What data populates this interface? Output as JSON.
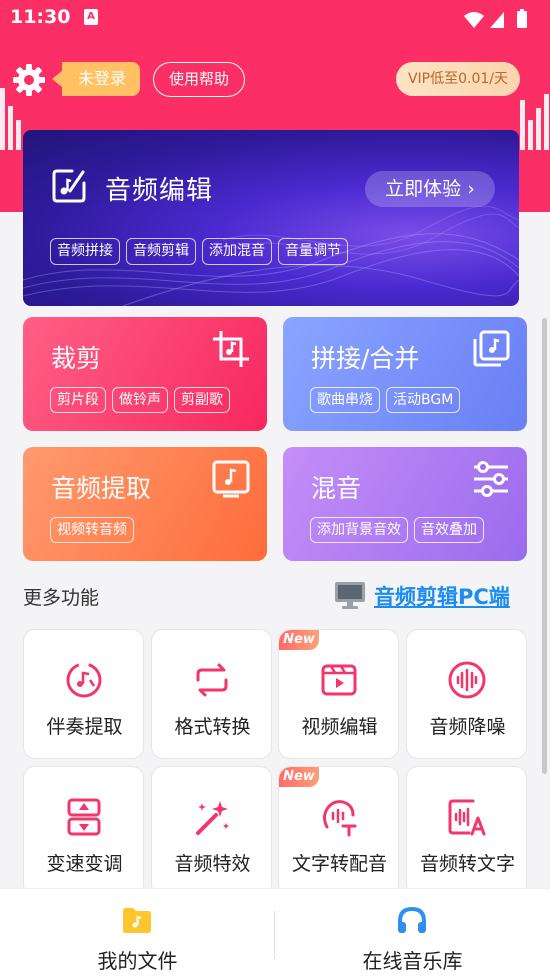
{
  "status_bar": {
    "time": "11:30",
    "notification_letter": "A"
  },
  "header": {
    "login_badge": "未登录",
    "help_button": "使用帮助",
    "vip_button": "VIP低至0.01/天"
  },
  "banner": {
    "title": "音频编辑",
    "cta": "立即体验",
    "tags": [
      "音频拼接",
      "音频剪辑",
      "添加混音",
      "音量调节"
    ]
  },
  "cards": [
    {
      "title": "裁剪",
      "tags": [
        "剪片段",
        "做铃声",
        "剪副歌"
      ],
      "icon": "crop-music-icon"
    },
    {
      "title": "拼接/合并",
      "tags": [
        "歌曲串烧",
        "活动BGM"
      ],
      "icon": "stack-music-icon"
    },
    {
      "title": "音频提取",
      "tags": [
        "视频转音频"
      ],
      "icon": "extract-music-icon"
    },
    {
      "title": "混音",
      "tags": [
        "添加背景音效",
        "音效叠加"
      ],
      "icon": "sliders-icon"
    }
  ],
  "more": {
    "title": "更多功能",
    "pc_link": "音频剪辑PC端"
  },
  "tools": [
    {
      "label": "伴奏提取",
      "icon": "accompaniment-icon",
      "new": false
    },
    {
      "label": "格式转换",
      "icon": "convert-icon",
      "new": false
    },
    {
      "label": "视频编辑",
      "icon": "video-edit-icon",
      "new": true
    },
    {
      "label": "音频降噪",
      "icon": "denoise-icon",
      "new": false
    },
    {
      "label": "变速变调",
      "icon": "speed-pitch-icon",
      "new": false
    },
    {
      "label": "音频特效",
      "icon": "magic-wand-icon",
      "new": false
    },
    {
      "label": "文字转配音",
      "icon": "text-to-speech-icon",
      "new": true
    },
    {
      "label": "音频转文字",
      "icon": "speech-to-text-icon",
      "new": false
    }
  ],
  "new_badge": "New",
  "bottom_nav": [
    {
      "label": "我的文件",
      "icon": "folder-icon"
    },
    {
      "label": "在线音乐库",
      "icon": "headphones-icon"
    }
  ],
  "colors": {
    "brand": "#fb2f66",
    "link": "#1b8cf0",
    "vip_text": "#b46a2a"
  }
}
